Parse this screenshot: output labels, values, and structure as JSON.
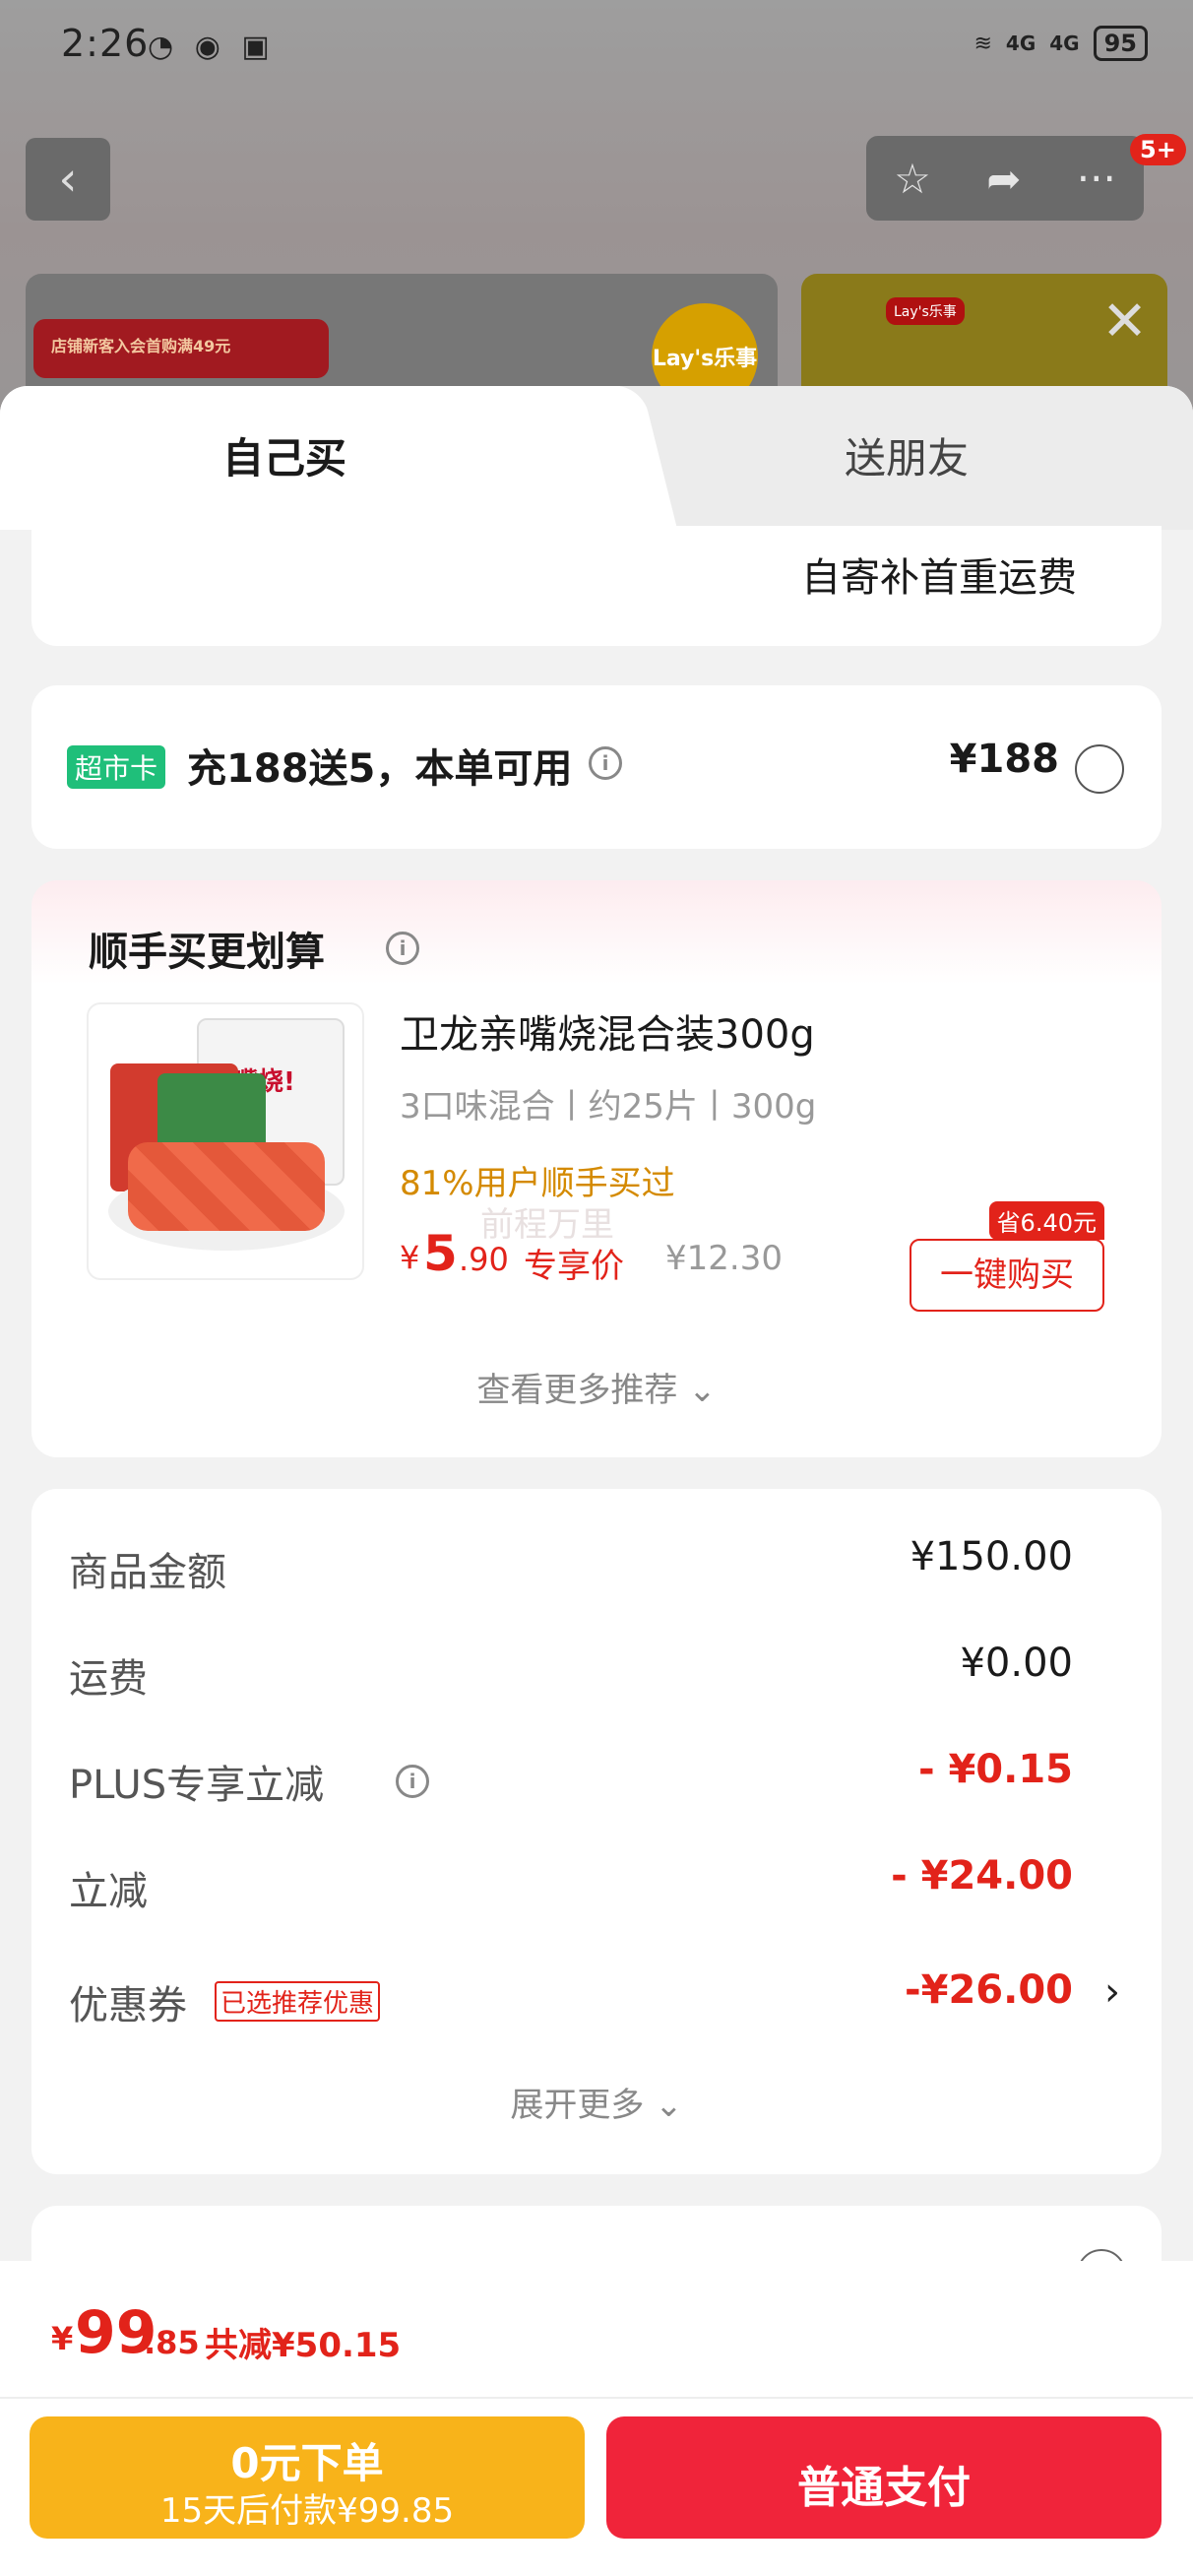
{
  "status_bar": {
    "time": "2:26",
    "battery": "95",
    "signal1": "4G",
    "signal2": "4G"
  },
  "header": {
    "notification_count": "5+"
  },
  "banner": {
    "promo_text": "店铺新客入会首购满49元",
    "brand_logo": "Lay's乐事"
  },
  "tabs": [
    {
      "label": "自己买"
    },
    {
      "label": "送朋友"
    }
  ],
  "shipping_note": "自寄补首重运费",
  "supermarket_card": {
    "tag": "超市卡",
    "title": "充188送5，本单可用",
    "price": "¥188"
  },
  "recommend": {
    "heading": "顺手买更划算",
    "product": {
      "name": "卫龙亲嘴烧混合装300g",
      "spec": "3口味混合丨约25片丨300g",
      "users": "81%用户顺手买过",
      "price_symbol": "¥",
      "price_int": "5",
      "price_dec": ".90",
      "price_label": "专享价",
      "original_price": "¥12.30",
      "save_badge": "省6.40元",
      "buy_button": "一键购买",
      "package_text": "亲嘴烧!"
    },
    "more_link": "查看更多推荐",
    "watermark": "前程万里"
  },
  "summary": {
    "rows": [
      {
        "label": "商品金额",
        "value": "¥150.00"
      },
      {
        "label": "运费",
        "value": "¥0.00"
      },
      {
        "label": "PLUS专享立减",
        "value": "- ¥0.15"
      },
      {
        "label": "立减",
        "value": "- ¥24.00"
      },
      {
        "label": "优惠券",
        "value": "-¥26.00",
        "tag": "已选推荐优惠"
      }
    ],
    "expand_link": "展开更多"
  },
  "checkout": {
    "total_symbol": "¥",
    "total_int": "99",
    "total_dec": ".85",
    "saved": "共减¥50.15",
    "pay_later_title": "0元下单",
    "pay_later_sub": "15天后付款¥99.85",
    "normal_pay": "普通支付"
  }
}
